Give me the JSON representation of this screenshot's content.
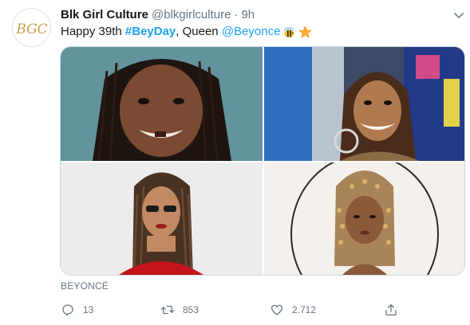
{
  "tweet": {
    "avatar_text": "BGC",
    "display_name": "Blk Girl Culture",
    "handle": "@blkgirlculture",
    "separator": "·",
    "time": "9h",
    "text_prefix": "Happy 39th ",
    "hashtag": "#BeyDay",
    "text_middle": ", Queen ",
    "mention": "@Beyonce",
    "emojis": [
      "bee-emoji",
      "star-emoji"
    ],
    "source": "BEYONCÉ",
    "actions": {
      "reply_count": "13",
      "retweet_count": "853",
      "like_count": "2.712"
    }
  },
  "colors": {
    "link": "#1da1f2",
    "secondary_text": "#657786",
    "primary_text": "#14171a",
    "border": "#ccd6dd",
    "avatar_gold": "#c9a14a"
  },
  "icons": {
    "caret": "chevron-down-icon",
    "reply": "reply-icon",
    "retweet": "retweet-icon",
    "like": "heart-icon",
    "share": "share-icon"
  }
}
